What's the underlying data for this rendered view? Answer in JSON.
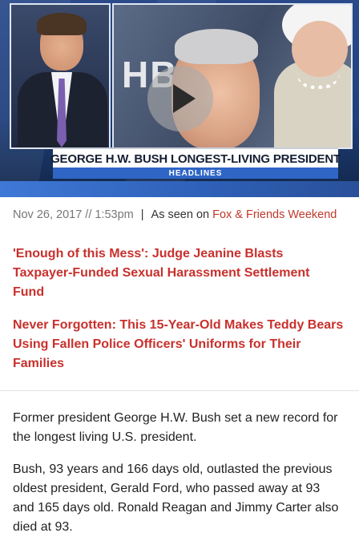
{
  "video": {
    "network_watermark": "HBO",
    "headline": "GEORGE H.W. BUSH LONGEST-LIVING PRESIDENT",
    "segment_label": "HEADLINES",
    "play_icon": "play-icon"
  },
  "meta": {
    "date": "Nov 26, 2017 // 1:53pm",
    "separator": "|",
    "seen_on_label": "As seen on",
    "show_name": "Fox & Friends Weekend"
  },
  "related_links": [
    {
      "title": "'Enough of this Mess': Judge Jeanine Blasts Taxpayer-Funded Sexual Harassment Settlement Fund"
    },
    {
      "title": "Never Forgotten: This 15-Year-Old Makes Teddy Bears Using Fallen Police Officers' Uniforms for Their Families"
    }
  ],
  "article": {
    "paragraphs": [
      "Former president George H.W. Bush set a new record for the longest living U.S. president.",
      "Bush, 93 years and 166 days old, outlasted the previous oldest president, Gerald Ford, who passed away at 93 and 165 days old. Ronald Reagan and Jimmy Carter also died at 93."
    ]
  },
  "colors": {
    "link_red": "#c8302c",
    "lower_third_blue": "#2f66c6"
  }
}
